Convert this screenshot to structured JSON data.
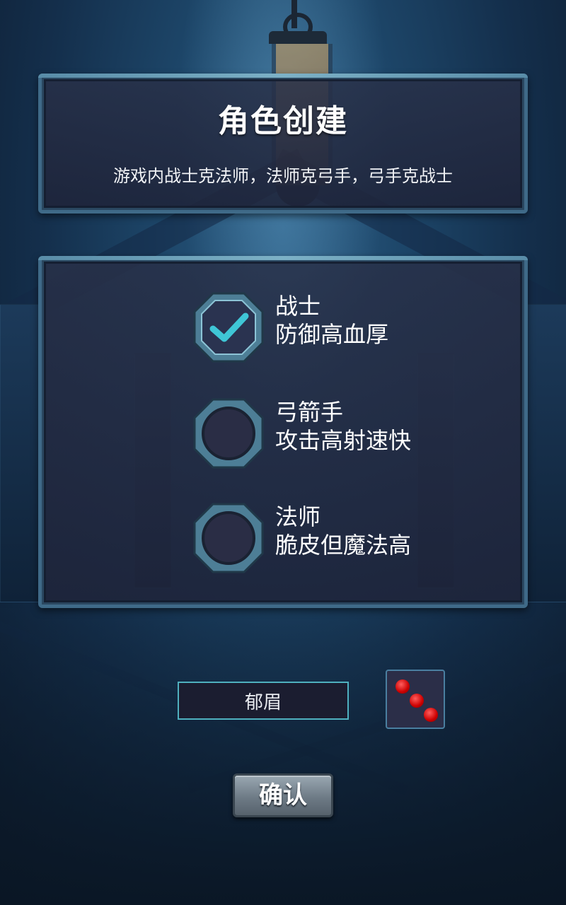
{
  "header": {
    "title": "角色创建",
    "subtitle": "游戏内战士克法师，法师克弓手，弓手克战士"
  },
  "classes": [
    {
      "name": "战士",
      "desc": "防御高血厚",
      "selected": true
    },
    {
      "name": "弓箭手",
      "desc": "攻击高射速快",
      "selected": false
    },
    {
      "name": "法师",
      "desc": "脆皮但魔法高",
      "selected": false
    }
  ],
  "name_input": {
    "value": "郁眉"
  },
  "dice": {
    "icon": "dice-icon",
    "pips": 3
  },
  "confirm": {
    "label": "确认"
  },
  "colors": {
    "accent": "#4fb0bf",
    "check": "#3fc6d6",
    "pip": "#e01010"
  }
}
